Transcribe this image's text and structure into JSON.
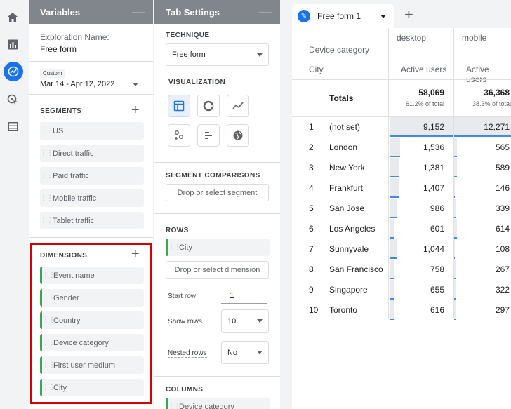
{
  "variables": {
    "title": "Variables",
    "exploration_label": "Exploration Name:",
    "exploration_name": "Free form",
    "date_badge": "Custom",
    "date_range": "Mar 14 - Apr 12, 2022",
    "segments_title": "SEGMENTS",
    "segments": [
      "US",
      "Direct traffic",
      "Paid traffic",
      "Mobile traffic",
      "Tablet traffic"
    ],
    "dimensions_title": "DIMENSIONS",
    "dimensions": [
      "Event name",
      "Gender",
      "Country",
      "Device category",
      "First user medium",
      "City"
    ]
  },
  "tab_settings": {
    "title": "Tab Settings",
    "technique_title": "TECHNIQUE",
    "technique_value": "Free form",
    "visualization_title": "VISUALIZATION",
    "visualizations": [
      "table-icon",
      "donut-icon",
      "line-chart-icon",
      "scatter-icon",
      "bar-chart-icon",
      "geo-map-icon"
    ],
    "segment_comparisons_title": "SEGMENT COMPARISONS",
    "segment_drop_placeholder": "Drop or select segment",
    "rows_title": "ROWS",
    "row_dimension": "City",
    "dimension_drop_placeholder": "Drop or select dimension",
    "start_row_label": "Start row",
    "start_row_value": "1",
    "show_rows_label": "Show rows",
    "show_rows_value": "10",
    "nested_rows_label": "Nested rows",
    "nested_rows_value": "No",
    "columns_title": "COLUMNS",
    "column_dimension": "Device category"
  },
  "report": {
    "tab_name": "Free form 1",
    "column_dimension_label": "Device category",
    "row_dimension_label": "City",
    "columns": [
      {
        "name": "desktop",
        "metric": "Active users",
        "total": "58,069",
        "share": "61.2% of total"
      },
      {
        "name": "mobile",
        "metric": "Active users",
        "total": "36,368",
        "share": "38.3% of total"
      }
    ],
    "totals_label": "Totals",
    "rows": [
      {
        "rank": "1",
        "city": "(not set)",
        "desktop": "9,152",
        "mobile": "12,271"
      },
      {
        "rank": "2",
        "city": "London",
        "desktop": "1,536",
        "mobile": "565"
      },
      {
        "rank": "3",
        "city": "New York",
        "desktop": "1,381",
        "mobile": "589"
      },
      {
        "rank": "4",
        "city": "Frankfurt",
        "desktop": "1,407",
        "mobile": "146"
      },
      {
        "rank": "5",
        "city": "San Jose",
        "desktop": "986",
        "mobile": "339"
      },
      {
        "rank": "6",
        "city": "Los Angeles",
        "desktop": "601",
        "mobile": "614"
      },
      {
        "rank": "7",
        "city": "Sunnyvale",
        "desktop": "1,044",
        "mobile": "108"
      },
      {
        "rank": "8",
        "city": "San Francisco",
        "desktop": "758",
        "mobile": "267"
      },
      {
        "rank": "9",
        "city": "Singapore",
        "desktop": "655",
        "mobile": "322"
      },
      {
        "rank": "10",
        "city": "Toronto",
        "desktop": "616",
        "mobile": "297"
      }
    ]
  },
  "colors": {
    "accent": "#1a73e8",
    "dimension": "#34a853",
    "highlight": "#d50000",
    "header": "#80868b"
  }
}
